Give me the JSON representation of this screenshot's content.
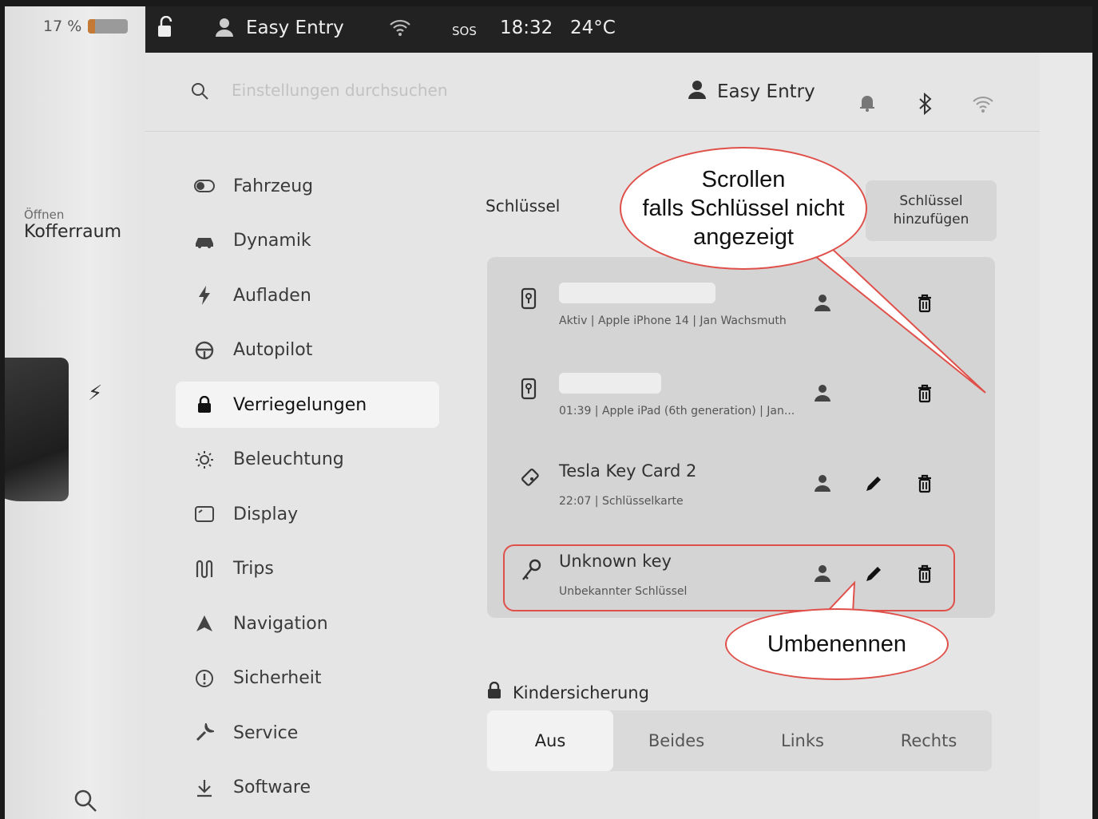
{
  "status": {
    "battery": "17 %",
    "battery_level": 0.17,
    "profile": "Easy Entry",
    "sos": "SOS",
    "time": "18:32",
    "temperature": "24°C"
  },
  "car": {
    "trunk_action": "Öffnen",
    "trunk_label": "Kofferraum"
  },
  "search": {
    "placeholder": "Einstellungen durchsuchen"
  },
  "header": {
    "profile": "Easy Entry"
  },
  "nav": [
    {
      "label": "Fahrzeug",
      "icon": "toggle-icon"
    },
    {
      "label": "Dynamik",
      "icon": "car-icon"
    },
    {
      "label": "Aufladen",
      "icon": "bolt-icon"
    },
    {
      "label": "Autopilot",
      "icon": "steering-wheel-icon"
    },
    {
      "label": "Verriegelungen",
      "icon": "lock-icon",
      "active": true
    },
    {
      "label": "Beleuchtung",
      "icon": "sun-icon"
    },
    {
      "label": "Display",
      "icon": "display-icon"
    },
    {
      "label": "Trips",
      "icon": "trips-icon"
    },
    {
      "label": "Navigation",
      "icon": "navigation-icon"
    },
    {
      "label": "Sicherheit",
      "icon": "safety-icon"
    },
    {
      "label": "Service",
      "icon": "wrench-icon"
    },
    {
      "label": "Software",
      "icon": "download-icon"
    }
  ],
  "keys": {
    "title": "Schlüssel",
    "add_line1": "Schlüssel",
    "add_line2": "hinzufügen",
    "items": [
      {
        "name": "",
        "meta": "Aktiv | Apple iPhone 14 | Jan Wachsmuth",
        "icon": "phone-key-icon"
      },
      {
        "name": "",
        "meta": "01:39 | Apple iPad (6th generation) | Jan...",
        "icon": "phone-key-icon"
      },
      {
        "name": "Tesla Key Card 2",
        "meta": "22:07 | Schlüsselkarte",
        "icon": "key-card-icon"
      },
      {
        "name": "Unknown key",
        "meta": "Unbekannter Schlüssel",
        "icon": "key-icon"
      }
    ]
  },
  "child_lock": {
    "title": "Kindersicherung",
    "options": [
      "Aus",
      "Beides",
      "Links",
      "Rechts"
    ],
    "selected": "Aus"
  },
  "annotations": {
    "scroll_line1": "Scrollen",
    "scroll_line2": "falls Schlüssel nicht",
    "scroll_line3": "angezeigt",
    "rename": "Umbenennen",
    "color": "#e0504a"
  }
}
